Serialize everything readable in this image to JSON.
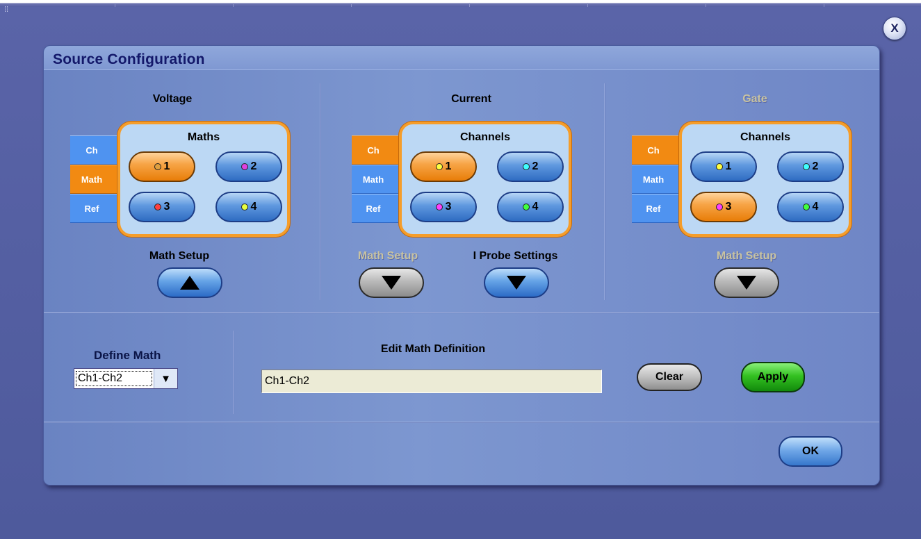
{
  "window": {
    "close_label": "X"
  },
  "dialog": {
    "title": "Source Configuration"
  },
  "source_tabs": [
    "Ch",
    "Math",
    "Ref"
  ],
  "voltage": {
    "title": "Voltage",
    "panel_title": "Maths",
    "active_tab": "Math",
    "buttons": [
      {
        "label": "1",
        "dot_color": "#e0a040",
        "active": true
      },
      {
        "label": "2",
        "dot_color": "#e040e0",
        "active": false
      },
      {
        "label": "3",
        "dot_color": "#ff4040",
        "active": false
      },
      {
        "label": "4",
        "dot_color": "#e8ff40",
        "active": false
      }
    ],
    "math_setup_label": "Math Setup"
  },
  "current": {
    "title": "Current",
    "panel_title": "Channels",
    "active_tab": "Ch",
    "buttons": [
      {
        "label": "1",
        "dot_color": "#ffff40",
        "active": true
      },
      {
        "label": "2",
        "dot_color": "#40ffff",
        "active": false
      },
      {
        "label": "3",
        "dot_color": "#ff40ff",
        "active": false
      },
      {
        "label": "4",
        "dot_color": "#40ff40",
        "active": false
      }
    ],
    "math_setup_label": "Math Setup",
    "probe_settings_label": "I Probe Settings"
  },
  "gate": {
    "title": "Gate",
    "panel_title": "Channels",
    "active_tab": "Ch",
    "buttons": [
      {
        "label": "1",
        "dot_color": "#ffff40",
        "active": false
      },
      {
        "label": "2",
        "dot_color": "#40ffff",
        "active": false
      },
      {
        "label": "3",
        "dot_color": "#ff40ff",
        "active": true
      },
      {
        "label": "4",
        "dot_color": "#40ff40",
        "active": false
      }
    ],
    "math_setup_label": "Math Setup"
  },
  "define_math": {
    "label": "Define Math",
    "selected": "Ch1-Ch2"
  },
  "edit_math": {
    "label": "Edit Math Definition",
    "value": "Ch1-Ch2"
  },
  "actions": {
    "clear_label": "Clear",
    "apply_label": "Apply",
    "ok_label": "OK"
  }
}
